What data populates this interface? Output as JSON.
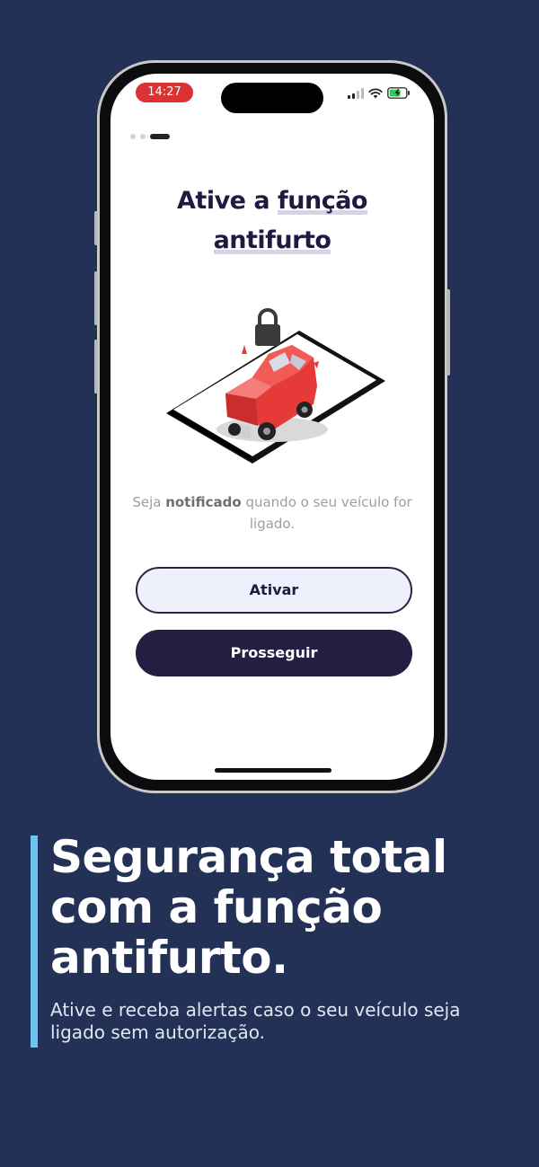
{
  "status_bar": {
    "time": "14:27",
    "signal_icon": "cellular-signal-icon",
    "wifi_icon": "wifi-icon",
    "battery_icon": "battery-charging-icon",
    "time_pill_color": "#d93333"
  },
  "pager": {
    "total": 3,
    "active_index": 2
  },
  "screen": {
    "title_line1_plain": "Ative a ",
    "title_line1_highlight": "função",
    "title_line2_highlight": "antifurto",
    "illustration_icons": [
      "lock-icon",
      "car-icon",
      "smartphone-icon"
    ],
    "subtitle_before": "Seja ",
    "subtitle_bold": "notificado",
    "subtitle_after": " quando o seu veículo for ligado.",
    "primary_outline_button": "Ativar",
    "primary_solid_button": "Prosseguir"
  },
  "promo": {
    "headline": "Segurança total com a função antifurto.",
    "caption": "Ative e receba alertas caso o seu veículo seja ligado sem autorização."
  },
  "colors": {
    "background": "#243156",
    "accent_bar": "#6fc3f3",
    "button_dark": "#261d43",
    "car_red": "#e63a38"
  }
}
